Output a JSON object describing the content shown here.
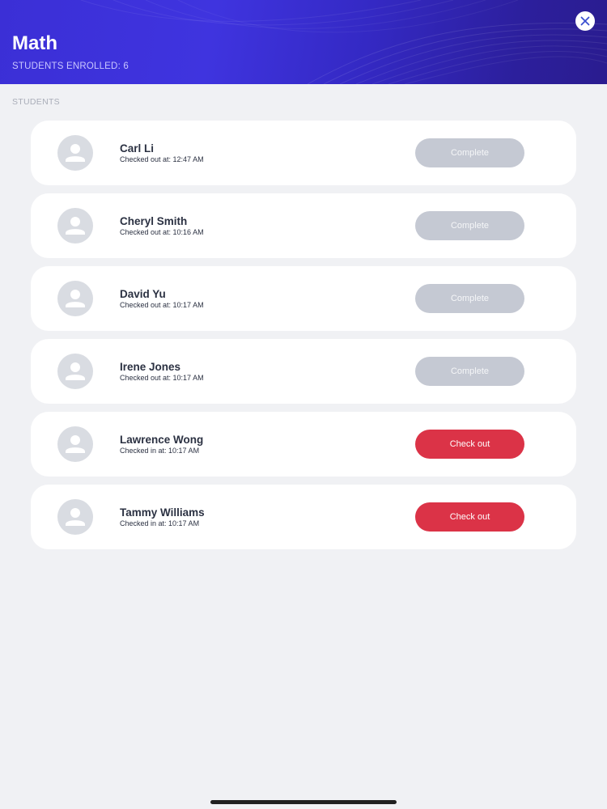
{
  "header": {
    "title": "Math",
    "subtitle": "STUDENTS ENROLLED: 6",
    "close_icon": "close-icon"
  },
  "section_label": "STUDENTS",
  "colors": {
    "header_accent": "#3b2fd6",
    "complete_button": "#c5c9d3",
    "checkout_button": "#db3347",
    "background": "#f0f1f4"
  },
  "students": [
    {
      "name": "Carl Li",
      "status": "Checked out at: 12:47 AM",
      "action": "Complete",
      "state": "complete"
    },
    {
      "name": "Cheryl Smith",
      "status": "Checked out at: 10:16 AM",
      "action": "Complete",
      "state": "complete"
    },
    {
      "name": "David Yu",
      "status": "Checked out at: 10:17 AM",
      "action": "Complete",
      "state": "complete"
    },
    {
      "name": "Irene Jones",
      "status": "Checked out at: 10:17 AM",
      "action": "Complete",
      "state": "complete"
    },
    {
      "name": "Lawrence Wong",
      "status": "Checked in at: 10:17 AM",
      "action": "Check out",
      "state": "checkout"
    },
    {
      "name": "Tammy Williams",
      "status": "Checked in at: 10:17 AM",
      "action": "Check out",
      "state": "checkout"
    }
  ]
}
